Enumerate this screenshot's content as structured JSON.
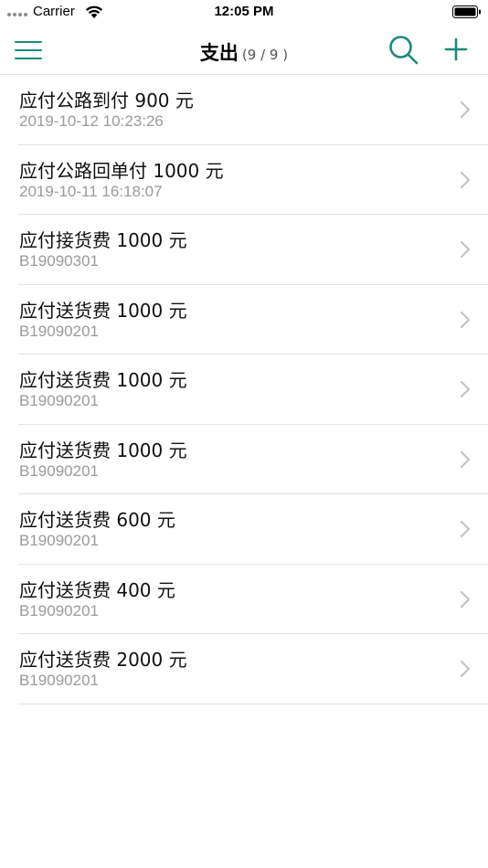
{
  "status_bar": {
    "carrier": "Carrier",
    "time": "12:05 PM"
  },
  "nav": {
    "title": "支出",
    "count": "(9 / 9 )",
    "accent_color": "#1b8a78",
    "icons": [
      "menu-icon",
      "search-icon",
      "plus-icon"
    ]
  },
  "items": [
    {
      "title": "应付公路到付 900 元",
      "subtitle": "2019-10-12 10:23:26"
    },
    {
      "title": "应付公路回单付 1000 元",
      "subtitle": "2019-10-11 16:18:07"
    },
    {
      "title": "应付接货费 1000 元",
      "subtitle": "B19090301"
    },
    {
      "title": "应付送货费 1000 元",
      "subtitle": "B19090201"
    },
    {
      "title": "应付送货费 1000 元",
      "subtitle": "B19090201"
    },
    {
      "title": "应付送货费 1000 元",
      "subtitle": "B19090201"
    },
    {
      "title": "应付送货费 600 元",
      "subtitle": "B19090201"
    },
    {
      "title": "应付送货费 400 元",
      "subtitle": "B19090201"
    },
    {
      "title": "应付送货费 2000 元",
      "subtitle": "B19090201"
    }
  ]
}
